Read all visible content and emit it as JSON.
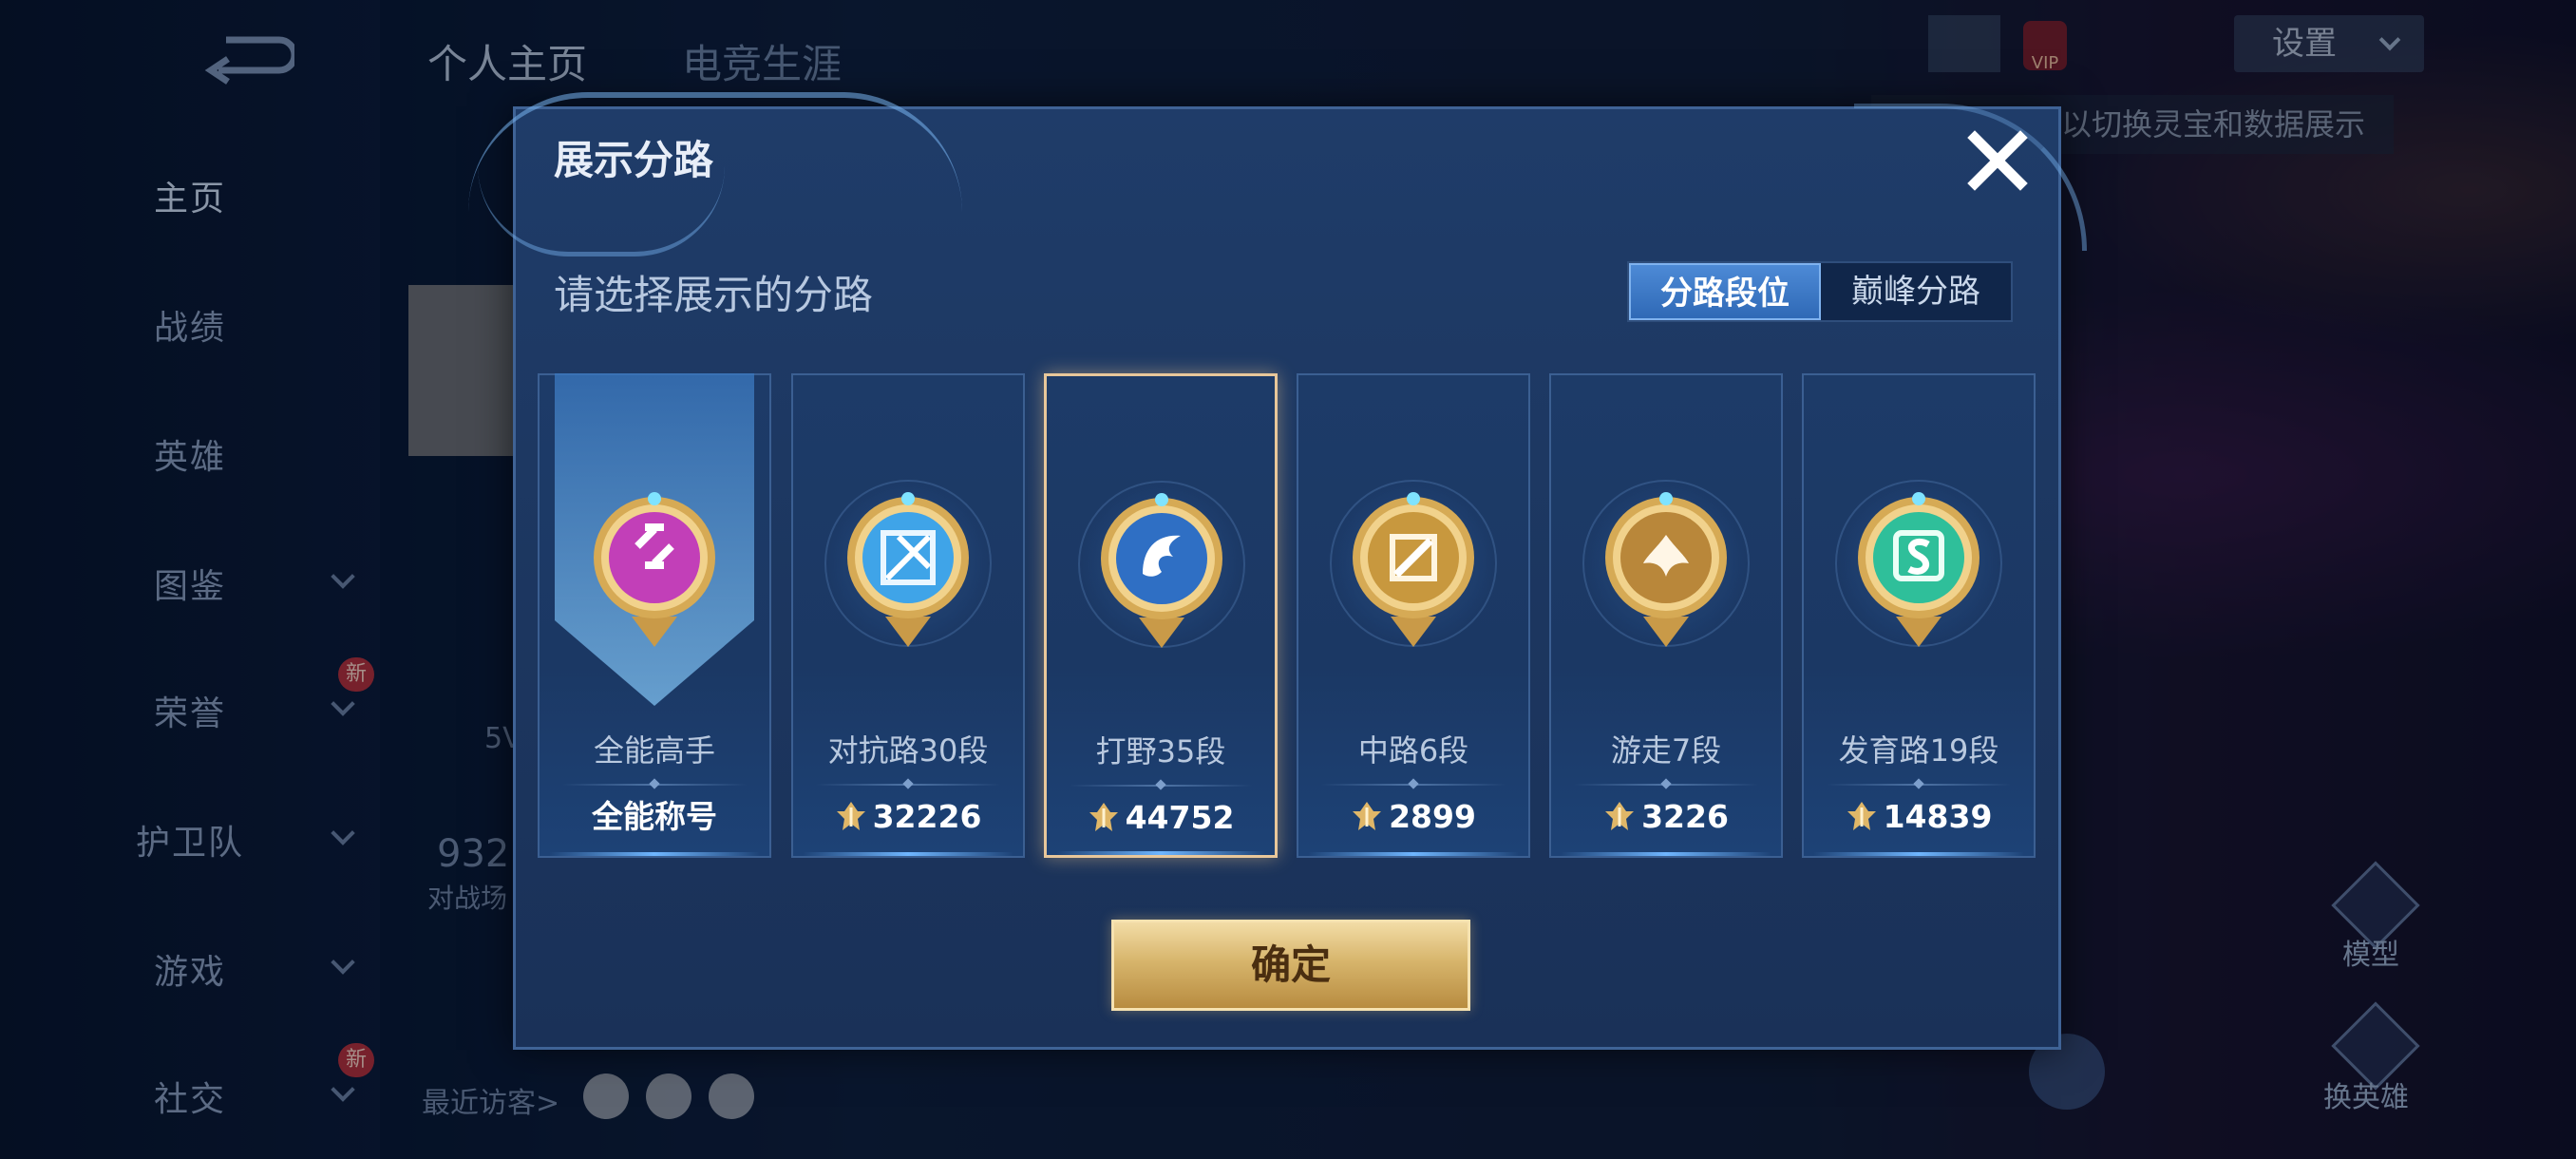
{
  "background": {
    "top_tabs": [
      "个人主页",
      "电竞生涯"
    ],
    "settings_label": "设置",
    "hint_text": "以切换灵宝和数据展示",
    "sidebar_items": [
      {
        "label": "主页",
        "has_chevron": false,
        "new": false
      },
      {
        "label": "战绩",
        "has_chevron": false,
        "new": false
      },
      {
        "label": "英雄",
        "has_chevron": false,
        "new": false
      },
      {
        "label": "图鉴",
        "has_chevron": true,
        "new": false
      },
      {
        "label": "荣誉",
        "has_chevron": true,
        "new": true
      },
      {
        "label": "护卫队",
        "has_chevron": true,
        "new": false
      },
      {
        "label": "游戏",
        "has_chevron": true,
        "new": false
      },
      {
        "label": "社交",
        "has_chevron": true,
        "new": true
      }
    ],
    "new_badge": "新",
    "recent_visitors_label": "最近访客>",
    "partial_number": "932",
    "partial_label": "对战场",
    "partial_5v": "5V",
    "right_buttons": [
      "模型",
      "换英雄"
    ],
    "vip_label": "VIP"
  },
  "modal": {
    "title": "展示分路",
    "subtitle": "请选择展示的分路",
    "tabs": [
      {
        "label": "分路段位",
        "active": true
      },
      {
        "label": "巅峰分路",
        "active": false
      }
    ],
    "confirm_label": "确定",
    "lanes": [
      {
        "name": "全能高手",
        "value": "全能称号",
        "has_power_icon": false,
        "selected": false,
        "emblem": "all-round-emblem-icon",
        "color": "#c23fb8"
      },
      {
        "name": "对抗路30段",
        "value": "32226",
        "has_power_icon": true,
        "selected": false,
        "emblem": "clash-lane-emblem-icon",
        "color": "#3fa4e8"
      },
      {
        "name": "打野35段",
        "value": "44752",
        "has_power_icon": true,
        "selected": true,
        "emblem": "jungle-emblem-icon",
        "color": "#2f6fc4"
      },
      {
        "name": "中路6段",
        "value": "2899",
        "has_power_icon": true,
        "selected": false,
        "emblem": "mid-lane-emblem-icon",
        "color": "#c8983e"
      },
      {
        "name": "游走7段",
        "value": "3226",
        "has_power_icon": true,
        "selected": false,
        "emblem": "roam-emblem-icon",
        "color": "#b9873a"
      },
      {
        "name": "发育路19段",
        "value": "14839",
        "has_power_icon": true,
        "selected": false,
        "emblem": "farm-lane-emblem-icon",
        "color": "#2fbf9a"
      }
    ]
  }
}
